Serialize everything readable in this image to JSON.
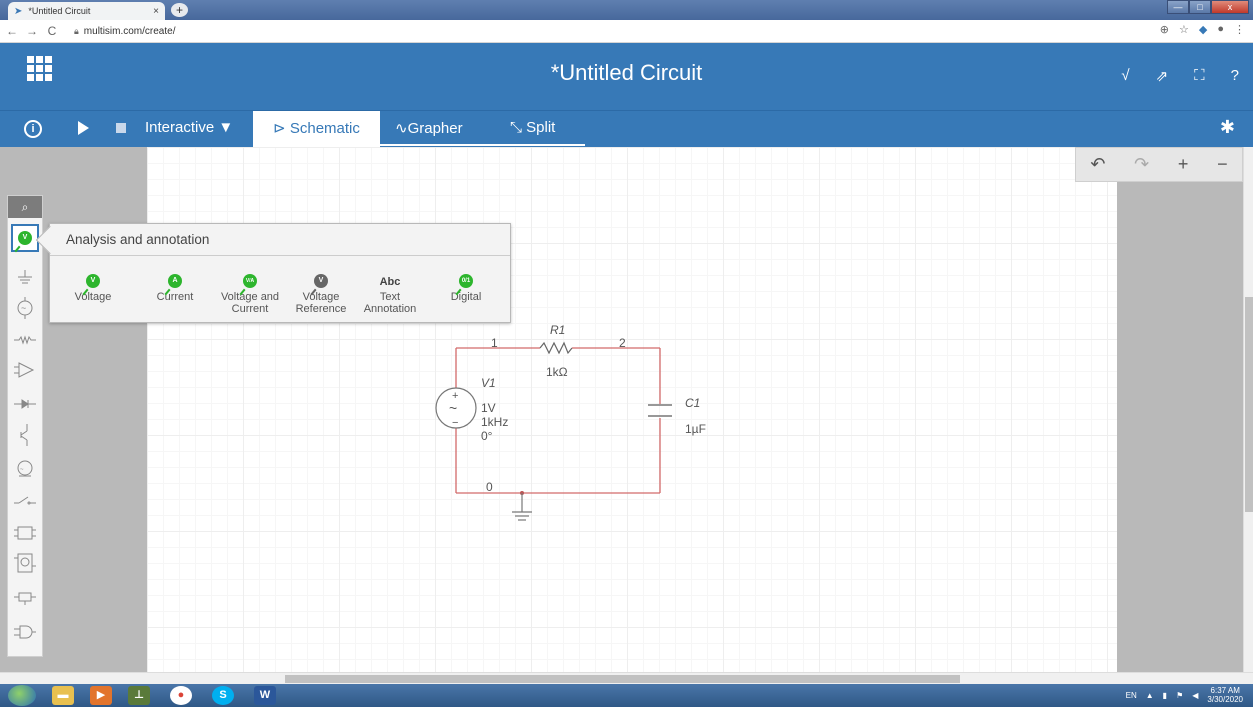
{
  "browser": {
    "tab_title": "*Untitled Circuit",
    "tab_close": "×",
    "new_tab": "+",
    "back": "←",
    "forward": "→",
    "reload": "C",
    "url": "multisim.com/create/",
    "minimize": "—",
    "maximize": "□",
    "close": "x"
  },
  "header": {
    "title": "*Untitled Circuit",
    "icons": [
      "√",
      "⇗",
      "⛶",
      "?"
    ]
  },
  "toolbar": {
    "info": "i",
    "mode": "Interactive ▼",
    "tabs": {
      "schematic": "⊳ Schematic",
      "grapher": "∿Grapher",
      "split": "⤡ Split"
    },
    "settings": "✱"
  },
  "undo_panel": {
    "undo": "↶",
    "redo": "↷",
    "zoom_in": "+",
    "zoom_out": "−"
  },
  "palette": {
    "search": "⌕"
  },
  "flyout": {
    "title": "Analysis and annotation",
    "items": [
      {
        "badge": "V",
        "line1": "Voltage",
        "line2": ""
      },
      {
        "badge": "A",
        "line1": "Current",
        "line2": ""
      },
      {
        "badge": "V/A",
        "line1": "Voltage and",
        "line2": "Current"
      },
      {
        "badge": "V",
        "line1": "Voltage",
        "line2": "Reference"
      },
      {
        "badge": "Abc",
        "line1": "Text",
        "line2": "Annotation"
      },
      {
        "badge": "0/1",
        "line1": "Digital",
        "line2": ""
      }
    ]
  },
  "circuit": {
    "node1": "1",
    "node2": "2",
    "node0": "0",
    "r1_name": "R1",
    "r1_value": "1kΩ",
    "v1_name": "V1",
    "v1_amp": "1V",
    "v1_freq": "1kHz",
    "v1_phase": "0°",
    "c1_name": "C1",
    "c1_value": "1µF"
  },
  "taskbar": {
    "lang": "EN",
    "time": "6:37 AM",
    "date": "3/30/2020"
  },
  "colors": {
    "brand_blue": "#3779b7",
    "wire_red": "#d26a6a",
    "probe_green": "#2db52d"
  }
}
